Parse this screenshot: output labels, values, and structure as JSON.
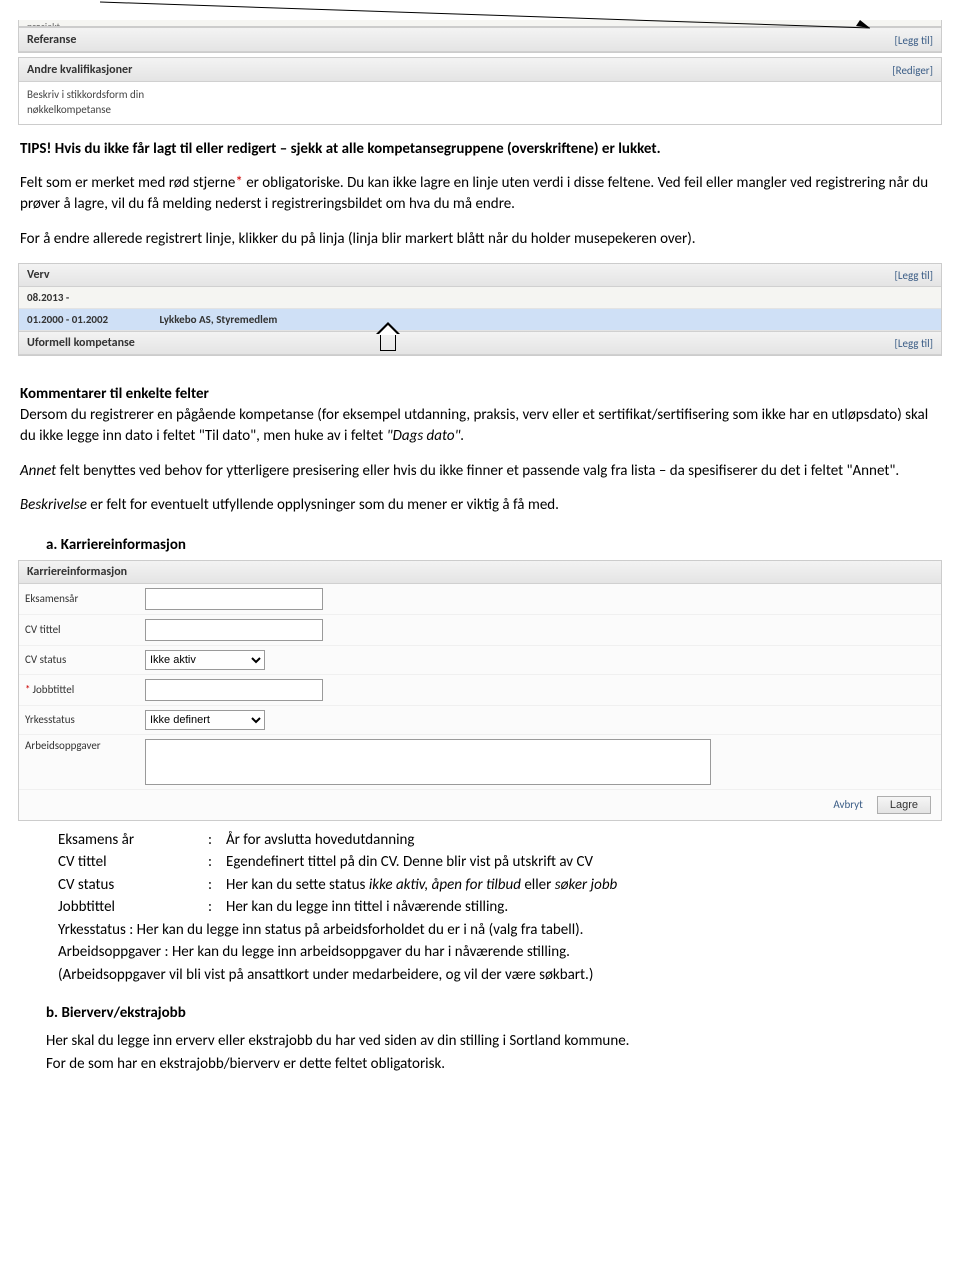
{
  "top_cut": "prosjekt…",
  "sections": {
    "referanse": {
      "title": "Referanse",
      "action": "[Legg til]"
    },
    "andre": {
      "title": "Andre kvalifikasjoner",
      "action": "[Rediger]",
      "body": "Beskriv i stikkordsform din\nnøkkelkompetanse"
    }
  },
  "annot_line": true,
  "para_tips": "TIPS! Hvis du ikke får lagt til eller redigert – sjekk at alle kompetansegruppene (overskriftene) er lukket.",
  "para_oblig_head": "Felt som er merket med rød stjerne",
  "para_oblig_star": "*",
  "para_oblig_tail": " er obligatoriske. Du kan ikke lagre en linje uten verdi i disse feltene. Ved feil eller mangler ved registrering når du prøver å lagre, vil du få melding nederst i registreringsbildet om hva du må endre.",
  "para_endre": "For å endre allerede registrert linje, klikker du på linja (linja blir markert blått når du holder musepekeren over).",
  "verv": {
    "title": "Verv",
    "action": "[Legg til]",
    "rows": [
      {
        "date": "08.2013 -",
        "text": "",
        "sel": false
      },
      {
        "date": "01.2000 - 01.2002",
        "text": "Lykkebo AS, Styremedlem",
        "sel": true
      }
    ],
    "uformell": {
      "title": "Uformell kompetanse",
      "action": "[Legg til]"
    }
  },
  "komm_hd": "Kommentarer til enkelte felter",
  "komm_p1": "Dersom du registrerer en pågående kompetanse (for eksempel utdanning, praksis, verv eller et sertifikat/sertifisering som ikke har en utløpsdato) skal du ikke legge inn dato i feltet \"Til dato\", men huke av i feltet ",
  "komm_p1_it": "\"Dags dato\".",
  "komm_p2_it": "Annet",
  "komm_p2": " felt benyttes ved behov for ytterligere presisering eller hvis du ikke finner et passende valg fra lista – da spesifiserer du det i feltet \"Annet\".",
  "komm_p3_it": "Beskrivelse",
  "komm_p3": " er felt for eventuelt utfyllende opplysninger som du mener er viktig å få med.",
  "a_title": "a.    Karriereinformasjon",
  "form": {
    "title": "Karriereinformasjon",
    "rows": [
      {
        "label": "Eksamensår",
        "type": "text"
      },
      {
        "label": "CV tittel",
        "type": "text"
      },
      {
        "label": "CV status",
        "type": "select",
        "value": "Ikke aktiv"
      },
      {
        "label": "Jobbtittel",
        "type": "text",
        "required": true
      },
      {
        "label": "Yrkesstatus",
        "type": "select",
        "value": "Ikke definert"
      },
      {
        "label": "Arbeidsoppgaver",
        "type": "textarea"
      }
    ],
    "cancel": "Avbryt",
    "save": "Lagre"
  },
  "defs": [
    {
      "k": "Eksamens år",
      "v": "År for avslutta hovedutdanning"
    },
    {
      "k": "CV tittel",
      "v": "Egendefinert tittel på din CV. Denne blir vist på utskrift av CV"
    },
    {
      "k": "CV status",
      "v": "Her kan du sette status ",
      "it": "ikke aktiv, åpen for tilbud",
      "tail": " eller ",
      "it2": "søker jobb"
    },
    {
      "k": "Jobbtittel",
      "v": "Her kan du legge inn tittel i nåværende stilling."
    }
  ],
  "defs_full": [
    "Yrkesstatus : Her kan du legge inn status på arbeidsforholdet du er i nå (valg fra tabell).",
    "Arbeidsoppgaver      : Her kan du legge inn arbeidsoppgaver du har i nåværende stilling.",
    "(Arbeidsoppgaver vil bli vist på ansattkort under medarbeidere, og vil der være søkbart.)"
  ],
  "b_title": "b.    Bierverv/ekstrajobb",
  "b_p1": "Her skal du legge inn erverv eller ekstrajobb du har ved siden av din stilling i Sortland kommune.",
  "b_p2": "For de som har en ekstrajobb/bierverv er dette feltet obligatorisk."
}
